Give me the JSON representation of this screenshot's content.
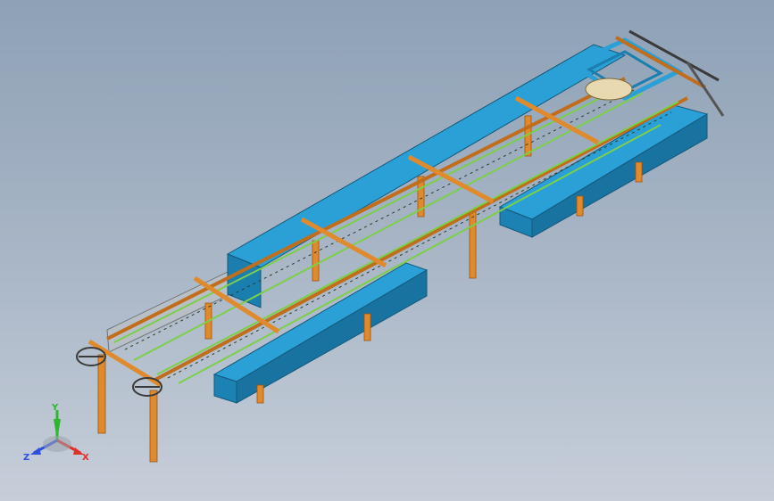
{
  "viewport": {
    "background_top": "#8ea1b6",
    "background_bottom": "#c6ced9"
  },
  "model": {
    "description_icon": "conveyor-assembly-3d-model",
    "colors": {
      "blue_body": "#1f8fc3",
      "blue_dark": "#17709a",
      "orange_beam": "#e08a2e",
      "orange_dark": "#b4651a",
      "green_rail": "#7ccf4a",
      "gray_panel": "#b9bfc6"
    }
  },
  "triad": {
    "x_label": "X",
    "y_label": "Y",
    "z_label": "Z",
    "x_color": "#e0302a",
    "y_color": "#2fb52f",
    "z_color": "#2f4fe0"
  }
}
